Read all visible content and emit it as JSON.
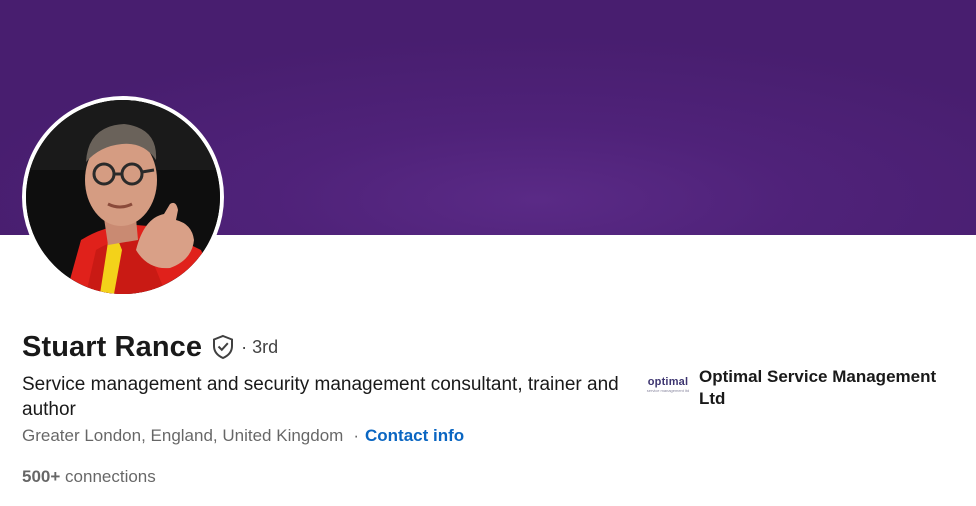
{
  "profile": {
    "name": "Stuart Rance",
    "degree": "· 3rd",
    "headline": "Service management and security management consultant, trainer and author",
    "location": "Greater London, England, United Kingdom",
    "separator": "·",
    "contact_label": "Contact info",
    "connections_count": "500+",
    "connections_label": "connections",
    "verified_icon": "shield-check-icon"
  },
  "company": {
    "name": "Optimal Service Management Ltd",
    "logo_text": "optimal",
    "logo_subtext": "service management ltd"
  },
  "colors": {
    "banner": "#4f2279",
    "link": "#0a66c2"
  }
}
